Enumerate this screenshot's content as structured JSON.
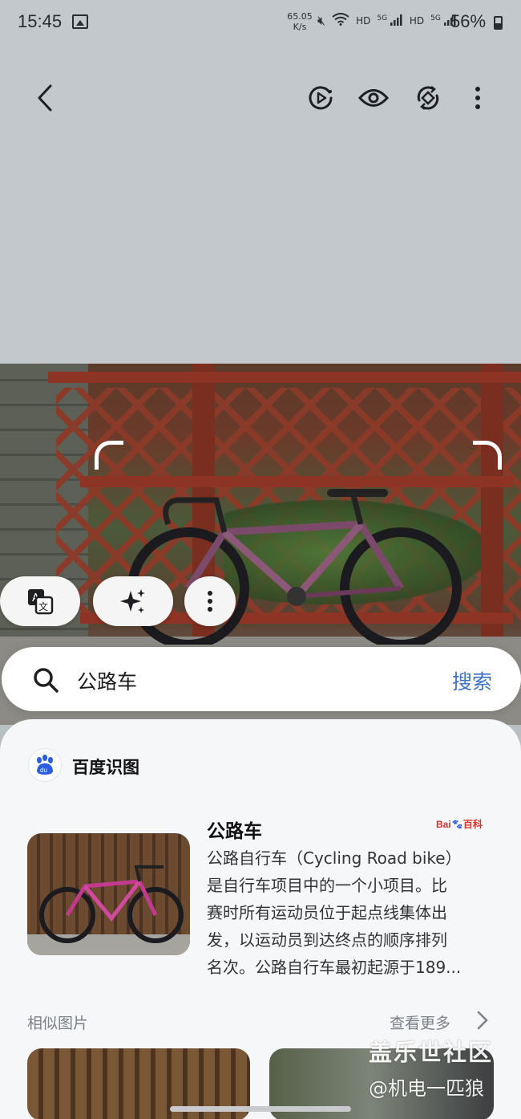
{
  "status_bar": {
    "time": "15:45",
    "net_speed_value": "65.05",
    "net_speed_unit": "K/s",
    "hd1": "HD",
    "sig1": "5G",
    "hd2": "HD",
    "sig2": "5G",
    "battery": "56%"
  },
  "toolbar": {
    "icons": [
      "back-icon",
      "motion-photo-icon",
      "eye-icon",
      "rotate-icon",
      "more-vert-icon"
    ]
  },
  "search": {
    "query": "公路车",
    "button": "搜索"
  },
  "source": {
    "name": "百度识图"
  },
  "result": {
    "title": "公路车",
    "badge_brand": "Bai",
    "badge_paw": "du",
    "badge_text": "百科",
    "desc_lines": [
      "公路自行车（Cycling Road bike）",
      "是自行车项目中的一个小项目。比",
      "赛时所有运动员位于起点线集体出",
      "发，以运动员到达终点的顺序排列",
      "名次。公路自行车最初起源于189..."
    ]
  },
  "similar": {
    "label": "相似图片",
    "see_more": "查看更多"
  },
  "watermark": {
    "line1": "盖乐世社区",
    "line2": "@机电一匹狼"
  },
  "colors": {
    "accent": "#3f73c6",
    "background": "#c3c8cd",
    "sheet": "#f6f7f9"
  }
}
